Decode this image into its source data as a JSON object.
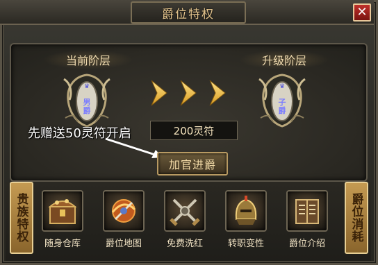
{
  "window": {
    "title": "爵位特权",
    "close_glyph": "✕"
  },
  "current_tier": {
    "label": "当前阶层",
    "rank": "男爵"
  },
  "next_tier": {
    "label": "升级阶层",
    "rank": "子爵"
  },
  "promo": {
    "hint": "先赠送50灵符开启",
    "cost": "200灵符"
  },
  "upgrade_button": {
    "label": "加官进爵"
  },
  "left_tab": {
    "label": "贵族特权"
  },
  "right_tab": {
    "label": "爵位消耗"
  },
  "features": [
    {
      "label": "随身仓库",
      "icon": "treasure-chest-icon"
    },
    {
      "label": "爵位地图",
      "icon": "map-orb-icon"
    },
    {
      "label": "免费洗红",
      "icon": "crossed-swords-icon"
    },
    {
      "label": "转职变性",
      "icon": "helmet-icon"
    },
    {
      "label": "爵位介绍",
      "icon": "book-icon"
    }
  ],
  "colors": {
    "accent_gold": "#e6c68e",
    "close_red": "#c0302a",
    "tab_gold": "#c49a52",
    "rank_purple": "#7a7cff"
  }
}
